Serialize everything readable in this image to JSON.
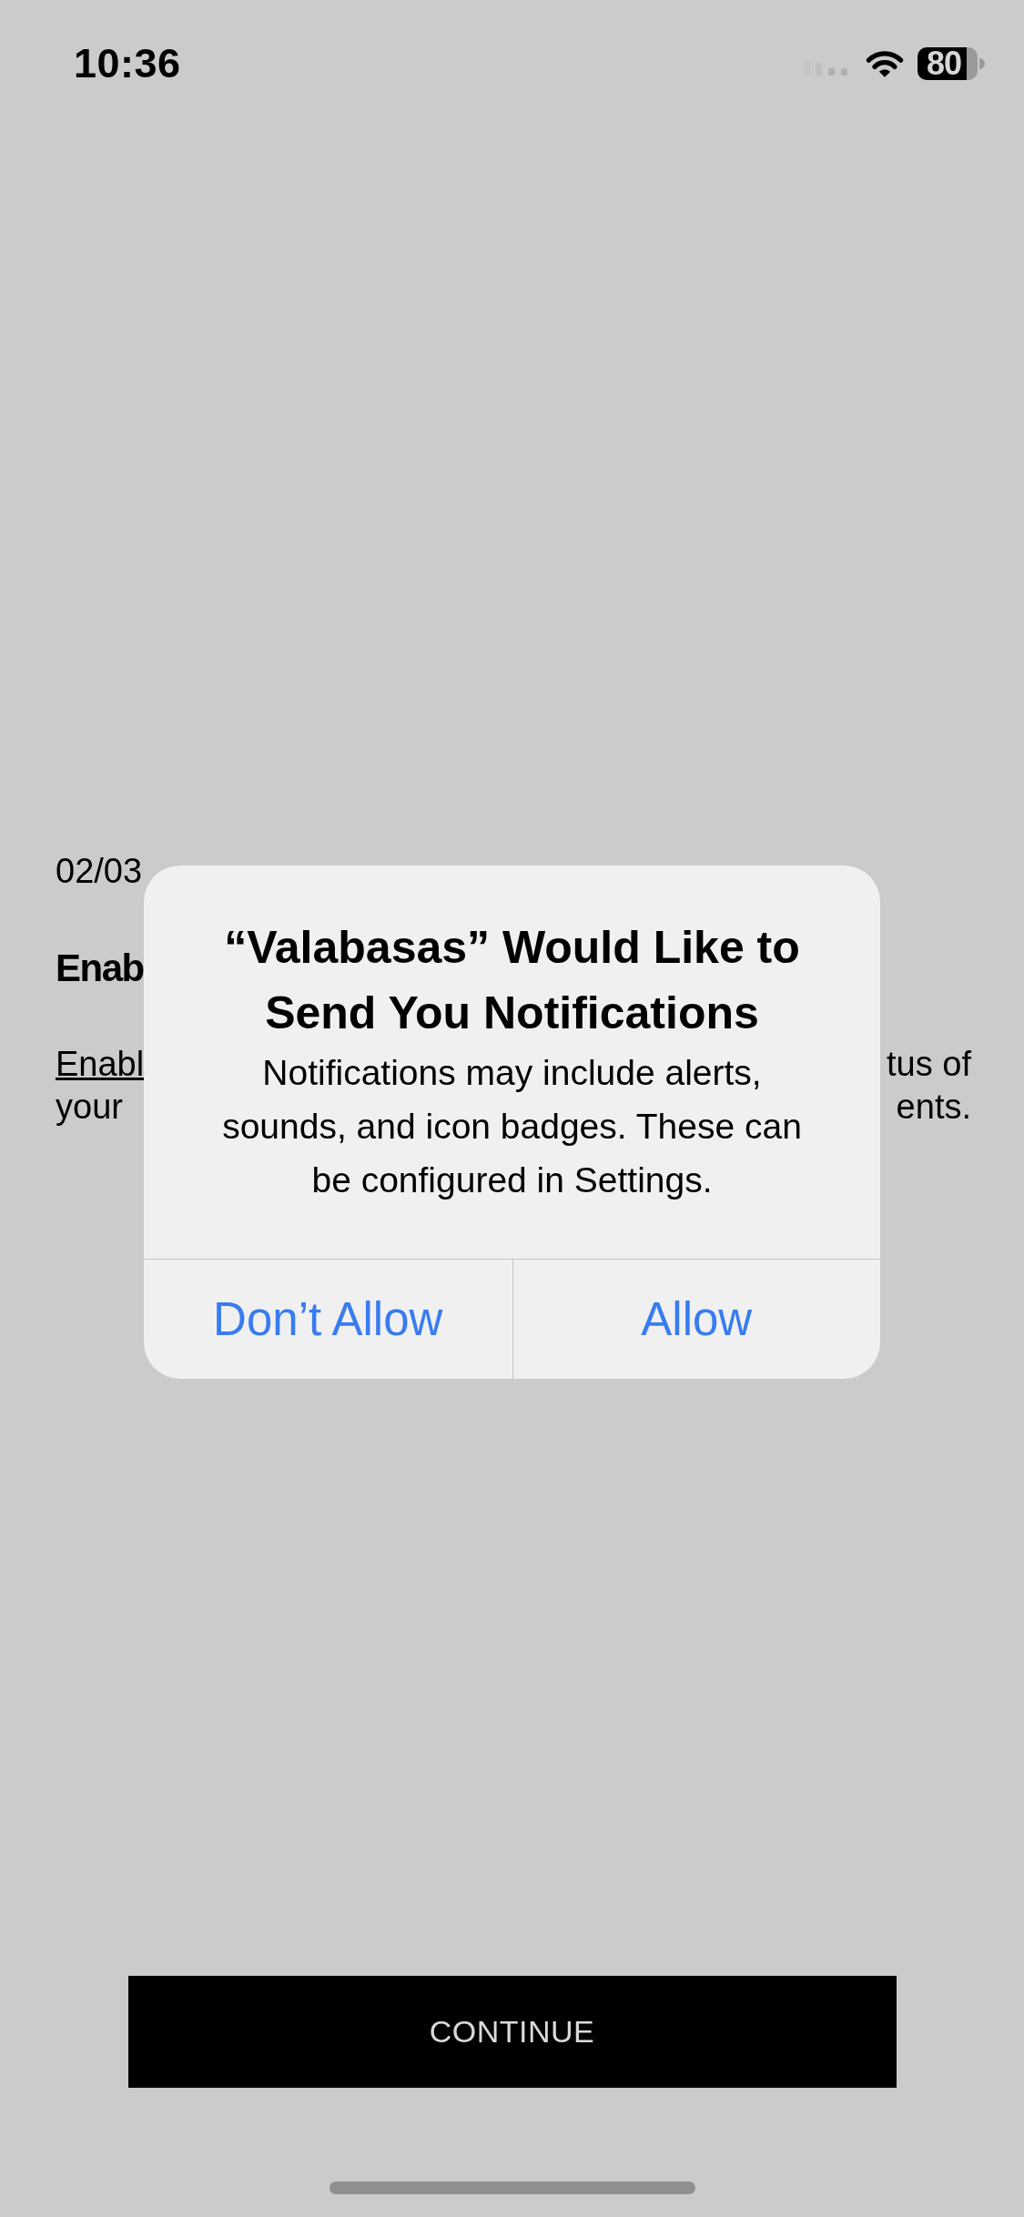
{
  "status_bar": {
    "time": "10:36",
    "battery_percent": "80"
  },
  "onboarding": {
    "step": "02/03",
    "heading": "Enab",
    "description_lines": [
      [
        {
          "kind": "link",
          "text": "Enabl"
        },
        {
          "kind": "text",
          "text": "tus of"
        }
      ],
      [
        {
          "kind": "text",
          "text": "your"
        },
        {
          "kind": "text",
          "text": "ents."
        }
      ]
    ],
    "continue_button": "CONTINUE"
  },
  "alert": {
    "title": "“Valabasas” Would Like to Send You Notifications",
    "message": "Notifications may include alerts, sounds, and icon badges. These can be configured in Settings.",
    "buttons": [
      "Don’t Allow",
      "Allow"
    ]
  }
}
